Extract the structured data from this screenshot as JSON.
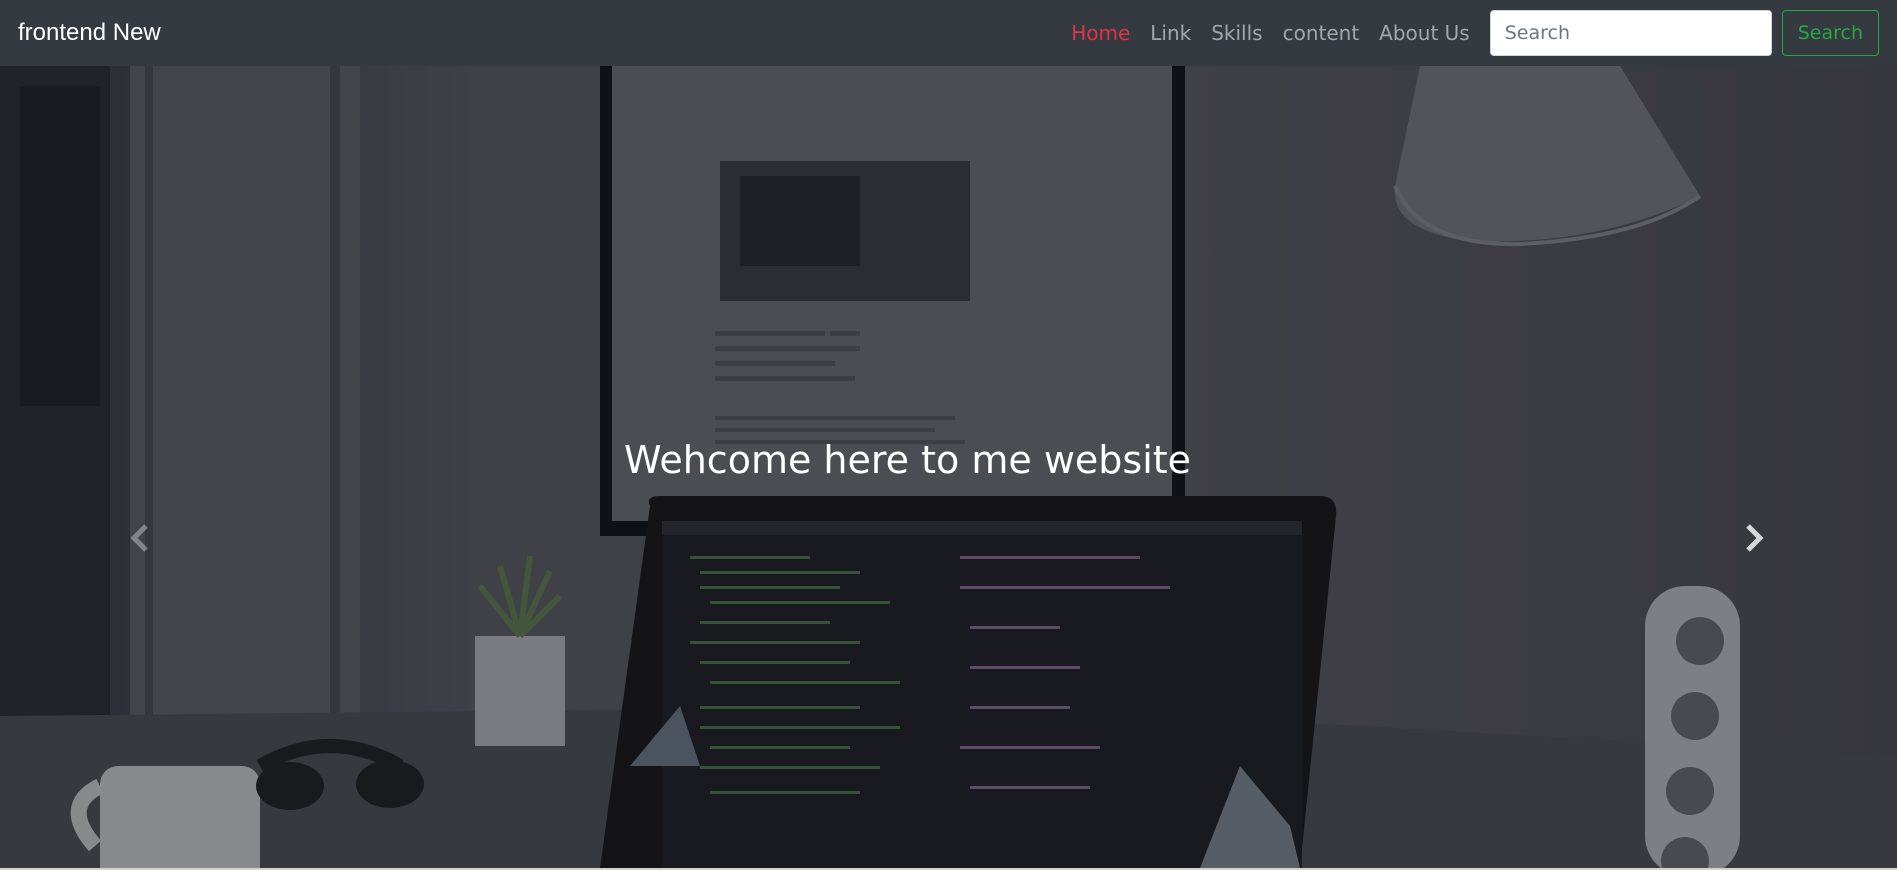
{
  "navbar": {
    "brand": "frontend New",
    "links": [
      {
        "label": "Home",
        "active": true
      },
      {
        "label": "Link",
        "active": false
      },
      {
        "label": "Skills",
        "active": false
      },
      {
        "label": "content",
        "active": false
      },
      {
        "label": "About Us",
        "active": false
      }
    ],
    "search": {
      "placeholder": "Search",
      "value": ""
    },
    "search_button": "Search"
  },
  "carousel": {
    "caption": "Wehcome here to me website",
    "prev_icon": "chevron-left-icon",
    "next_icon": "chevron-right-icon"
  },
  "colors": {
    "navbar_bg": "#343a40",
    "active_link": "#dc3545",
    "success": "#28a745"
  }
}
